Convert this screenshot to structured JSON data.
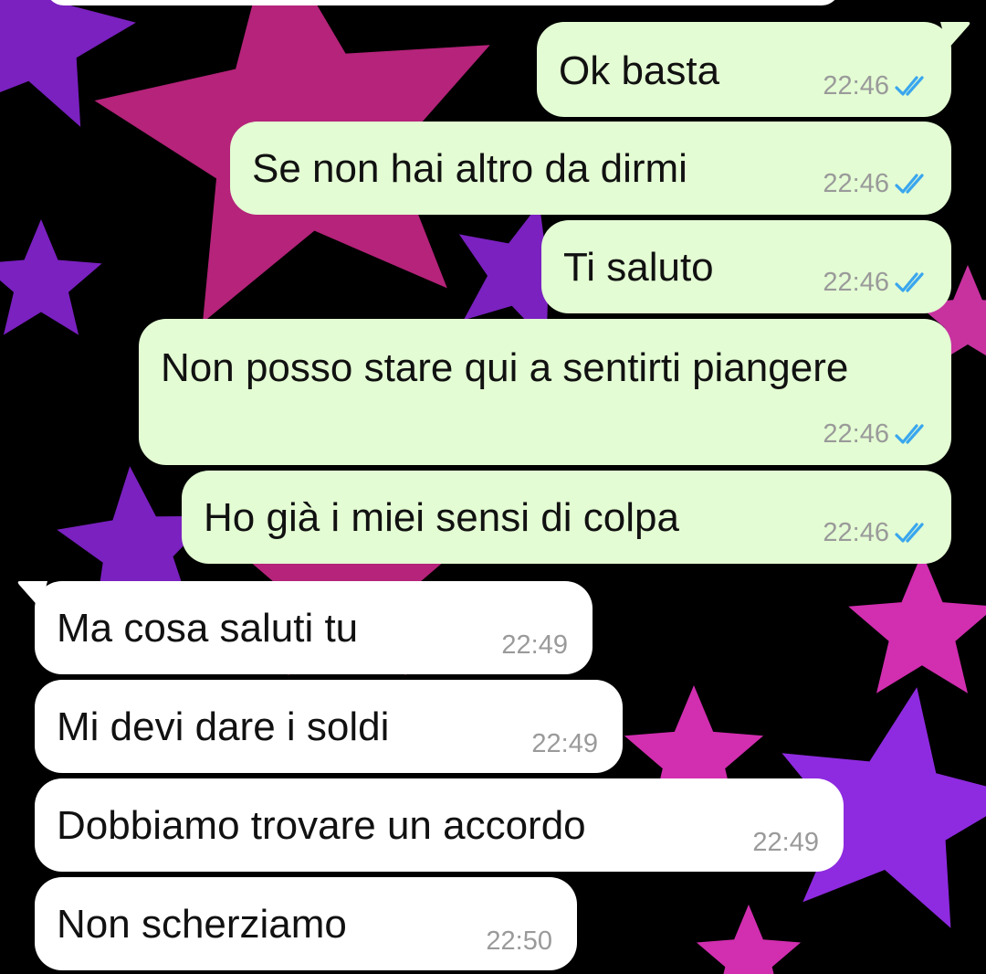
{
  "chat": {
    "wallpaper": {
      "background": "#000000",
      "star_colors": [
        "#b5237a",
        "#7a21c0",
        "#d22eb0",
        "#8e2be0",
        "#c7329f"
      ]
    },
    "colors": {
      "outgoing_bubble": "#e3fcd3",
      "incoming_bubble": "#ffffff",
      "read_ticks": "#3aa6ee",
      "timestamp": "#9a9a9a"
    },
    "messages": [
      {
        "direction": "outgoing",
        "text": "Ok basta",
        "time": "22:46",
        "status_icon": "double-check-read-icon"
      },
      {
        "direction": "outgoing",
        "text": "Se non hai altro da dirmi",
        "time": "22:46",
        "status_icon": "double-check-read-icon"
      },
      {
        "direction": "outgoing",
        "text": "Ti saluto",
        "time": "22:46",
        "status_icon": "double-check-read-icon"
      },
      {
        "direction": "outgoing",
        "text": "Non posso stare qui a sentirti piangere",
        "time": "22:46",
        "status_icon": "double-check-read-icon"
      },
      {
        "direction": "outgoing",
        "text": "Ho già i miei sensi di colpa",
        "time": "22:46",
        "status_icon": "double-check-read-icon"
      },
      {
        "direction": "incoming",
        "text": "Ma cosa saluti tu",
        "time": "22:49"
      },
      {
        "direction": "incoming",
        "text": "Mi devi dare i soldi",
        "time": "22:49"
      },
      {
        "direction": "incoming",
        "text": "Dobbiamo trovare un accordo",
        "time": "22:49"
      },
      {
        "direction": "incoming",
        "text": "Non scherziamo",
        "time": "22:50"
      }
    ]
  }
}
